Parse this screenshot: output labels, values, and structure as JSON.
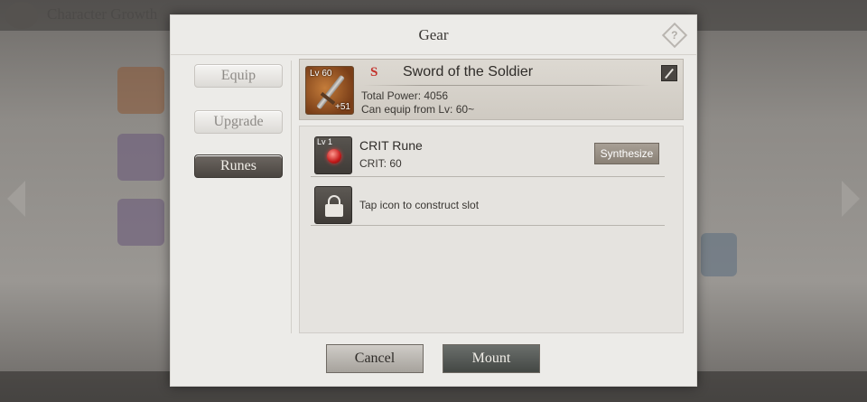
{
  "background": {
    "screen_title": "Character Growth"
  },
  "modal": {
    "title": "Gear"
  },
  "tabs": [
    {
      "label": "Equip",
      "active": false
    },
    {
      "label": "Upgrade",
      "active": false
    },
    {
      "label": "Runes",
      "active": true
    }
  ],
  "item": {
    "level": "Lv 60",
    "enhance": "+51",
    "rank": "S",
    "name": "Sword of the Soldier",
    "total_power": "Total Power: 4056",
    "equip_req": "Can equip from Lv: 60~"
  },
  "runes": {
    "slot1": {
      "level": "Lv 1",
      "name": "CRIT Rune",
      "stat": "CRIT: 60",
      "action_label": "Synthesize"
    },
    "slot2": {
      "hint": "Tap icon to construct slot"
    }
  },
  "footer": {
    "cancel_label": "Cancel",
    "mount_label": "Mount"
  },
  "colors": {
    "rank_red": "#c3302a",
    "active_tab": "#4a4540",
    "panel_bg": "#ecebe8"
  }
}
